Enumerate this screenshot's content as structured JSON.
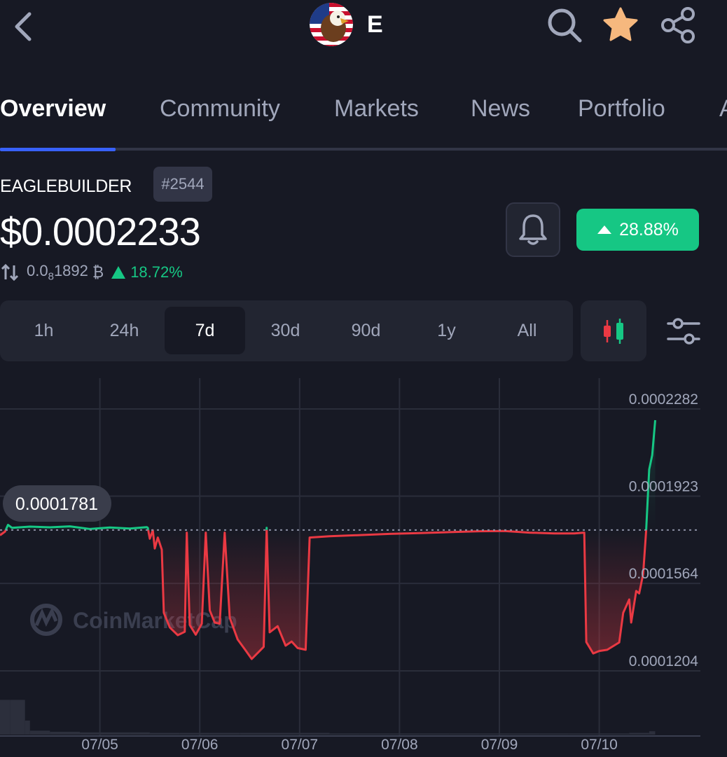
{
  "header": {
    "ticker": "E",
    "icons": [
      "back-icon",
      "search-icon",
      "star-icon",
      "share-icon"
    ]
  },
  "tabs": [
    {
      "label": "Overview",
      "active": true
    },
    {
      "label": "Community",
      "active": false
    },
    {
      "label": "Markets",
      "active": false
    },
    {
      "label": "News",
      "active": false
    },
    {
      "label": "Portfolio",
      "active": false
    },
    {
      "label": "A",
      "active": false
    }
  ],
  "coin": {
    "name": "EAGLEBUILDER",
    "rank": "#2544",
    "price": "$0.0002233",
    "btc_price_prefix": "0.0",
    "btc_price_subscript": "8",
    "btc_price_digits": "1892",
    "btc_symbol": "₿",
    "btc_change": "18.72%",
    "change_7d": "28.88%"
  },
  "range": {
    "options": [
      "1h",
      "24h",
      "7d",
      "30d",
      "90d",
      "1y",
      "All"
    ],
    "selected": "7d"
  },
  "colors": {
    "background": "#171924",
    "up": "#16c784",
    "down": "#ea3943",
    "accent": "#3861fb",
    "muted": "#a1a7bb"
  },
  "chart_data": {
    "type": "line",
    "watermark": "CoinMarketCap",
    "reference_value": 0.0001781,
    "reference_label": "0.0001781",
    "y_ticks": [
      "0.0002282",
      "0.0001923",
      "0.0001564",
      "0.0001204"
    ],
    "y_tick_values": [
      0.0002282,
      0.0001923,
      0.0001564,
      0.0001204
    ],
    "x_ticks": [
      "07/05",
      "07/06",
      "07/07",
      "07/08",
      "07/09",
      "07/10"
    ],
    "x_tick_positions": [
      1.0,
      2.0,
      3.0,
      4.0,
      5.0,
      6.0
    ],
    "x_range": [
      0.0,
      6.93
    ],
    "ylim": [
      0.00011,
      0.0002395
    ],
    "grid": true,
    "series": [
      {
        "points": [
          [
            0.0,
            0.0001759
          ],
          [
            0.05,
            0.0001774
          ],
          [
            0.08,
            0.0001802
          ],
          [
            0.12,
            0.000179
          ],
          [
            0.3,
            0.0001795
          ],
          [
            0.5,
            0.0001792
          ],
          [
            0.7,
            0.0001796
          ],
          [
            0.9,
            0.0001785
          ],
          [
            1.1,
            0.0001791
          ],
          [
            1.3,
            0.0001787
          ],
          [
            1.47,
            0.0001793
          ],
          [
            1.48,
            0.000179
          ],
          [
            1.5,
            0.0001745
          ],
          [
            1.53,
            0.000178
          ],
          [
            1.55,
            0.0001705
          ],
          [
            1.58,
            0.000175
          ],
          [
            1.62,
            0.00017
          ],
          [
            1.64,
            0.000144
          ],
          [
            1.7,
            0.000138
          ],
          [
            1.78,
            0.0001348
          ],
          [
            1.85,
            0.0001362
          ],
          [
            1.87,
            0.000177
          ],
          [
            1.9,
            0.000139
          ],
          [
            1.96,
            0.000135
          ],
          [
            2.02,
            0.0001395
          ],
          [
            2.06,
            0.000177
          ],
          [
            2.1,
            0.000145
          ],
          [
            2.15,
            0.00014
          ],
          [
            2.2,
            0.0001395
          ],
          [
            2.25,
            0.000177
          ],
          [
            2.3,
            0.000142
          ],
          [
            2.38,
            0.000133
          ],
          [
            2.46,
            0.0001285
          ],
          [
            2.52,
            0.000125
          ],
          [
            2.58,
            0.0001275
          ],
          [
            2.64,
            0.00013
          ],
          [
            2.67,
            0.000179
          ],
          [
            2.7,
            0.000136
          ],
          [
            2.78,
            0.0001385
          ],
          [
            2.86,
            0.0001305
          ],
          [
            2.92,
            0.0001322
          ],
          [
            2.98,
            0.0001295
          ],
          [
            3.06,
            0.0001288
          ],
          [
            3.1,
            0.000175
          ],
          [
            3.3,
            0.0001755
          ],
          [
            3.6,
            0.000176
          ],
          [
            3.9,
            0.0001765
          ],
          [
            4.2,
            0.0001768
          ],
          [
            4.5,
            0.0001772
          ],
          [
            4.8,
            0.0001776
          ],
          [
            5.05,
            0.0001777
          ],
          [
            5.3,
            0.000177
          ],
          [
            5.55,
            0.0001767
          ],
          [
            5.75,
            0.0001767
          ],
          [
            5.85,
            0.000177
          ],
          [
            5.87,
            0.000132
          ],
          [
            5.94,
            0.0001273
          ],
          [
            6.0,
            0.0001283
          ],
          [
            6.08,
            0.0001288
          ],
          [
            6.2,
            0.0001318
          ],
          [
            6.24,
            0.000144
          ],
          [
            6.3,
            0.0001495
          ],
          [
            6.32,
            0.00014
          ],
          [
            6.37,
            0.000153
          ],
          [
            6.4,
            0.000152
          ],
          [
            6.44,
            0.00016
          ],
          [
            6.47,
            0.000178
          ],
          [
            6.5,
            0.000203
          ],
          [
            6.53,
            0.0002089
          ],
          [
            6.56,
            0.0002233
          ]
        ]
      }
    ],
    "volume": [
      [
        0.0,
        0.62
      ],
      [
        0.1,
        0.62
      ],
      [
        0.2,
        0.62
      ],
      [
        0.25,
        0.25
      ],
      [
        0.3,
        0.07
      ],
      [
        0.5,
        0.05
      ],
      [
        0.8,
        0.04
      ],
      [
        1.0,
        0.04
      ],
      [
        1.3,
        0.04
      ],
      [
        1.5,
        0.03
      ],
      [
        1.8,
        0.03
      ],
      [
        2.1,
        0.03
      ],
      [
        2.4,
        0.03
      ],
      [
        2.7,
        0.03
      ],
      [
        3.0,
        0.03
      ],
      [
        3.3,
        0.02
      ],
      [
        3.6,
        0.02
      ],
      [
        3.9,
        0.02
      ],
      [
        4.2,
        0.02
      ],
      [
        4.5,
        0.02
      ],
      [
        4.8,
        0.02
      ],
      [
        5.1,
        0.02
      ],
      [
        5.4,
        0.02
      ],
      [
        5.7,
        0.02
      ],
      [
        6.0,
        0.02
      ],
      [
        6.3,
        0.03
      ],
      [
        6.5,
        0.06
      ],
      [
        6.56,
        0.08
      ]
    ]
  }
}
